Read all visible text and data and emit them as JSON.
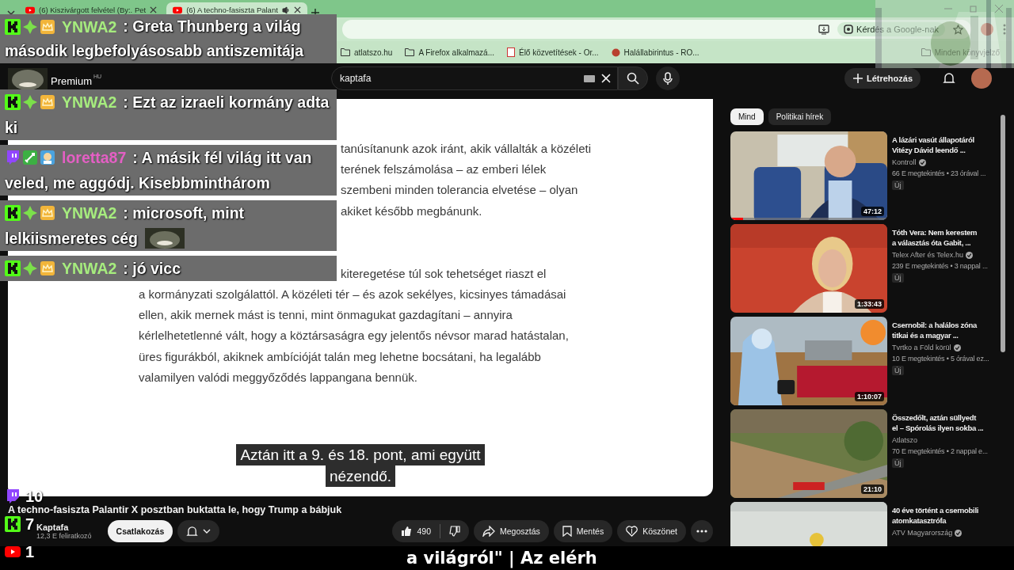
{
  "browser": {
    "tabs": [
      {
        "title": "(6) Kiszivárgott felvétel (By:. Pet",
        "selected": false,
        "audio": false
      },
      {
        "title": "(6) A techno-fasiszta Palant",
        "selected": true,
        "audio": true
      }
    ],
    "ask_google": "Kérdés a Google-nak",
    "bookmarks": [
      {
        "label": "atlatszo.hu",
        "kind": "folder"
      },
      {
        "label": "A Firefox alkalmazá...",
        "kind": "folder"
      },
      {
        "label": "Élő közvetítések - Or...",
        "kind": "live"
      },
      {
        "label": "Halállabirintus - RO...",
        "kind": "game"
      }
    ],
    "all_bookmarks": "Minden könyvjelző"
  },
  "youtube": {
    "premium": "Premium",
    "region": "HU",
    "search": {
      "value": "kaptafa"
    },
    "create": "Létrehozás"
  },
  "video": {
    "document": {
      "paragraphs": [
        {
          "lines": [
            {
              "text": "tanúsítanunk azok iránt, akik vállalták a közéleti",
              "kind": "fragment"
            },
            {
              "text": "terének felszámolása – az emberi lélek",
              "kind": "fragment"
            },
            {
              "text": "szembeni minden tolerancia elvetése – olyan",
              "kind": "fragment"
            },
            {
              "text": "akiket később megbánunk.",
              "kind": "fragment"
            }
          ]
        },
        {
          "lines": [
            {
              "text": "kiteregetése túl sok tehetséget riaszt el",
              "kind": "fragment"
            },
            {
              "text": "a kormányzati szolgálattól. A közéleti tér – és azok sekélyes, kicsinyes támadásai",
              "kind": "line"
            },
            {
              "text": "ellen, akik mernek mást is tenni, mint önmagukat gazdagítani – annyira",
              "kind": "line"
            },
            {
              "text": "kérlelhetetlenné vált, hogy a köztársaságra egy jelentős névsor marad hatástalan,",
              "kind": "line"
            },
            {
              "text": "üres figurákból, akiknek ambícióját talán meg lehetne bocsátani, ha legalább",
              "kind": "line"
            },
            {
              "text": "valamilyen valódi meggyőződés lappangana bennük.",
              "kind": "line"
            }
          ]
        }
      ]
    },
    "captions": [
      "Aztán itt a 9. és 18. pont, ami együtt",
      "nézendő."
    ],
    "title": "A techno-fasiszta Palantir X posztban buktatta le, hogy Trump a bábjuk",
    "channel": {
      "name": "Kaptafa",
      "subscribers": "12,3 E feliratkozó"
    },
    "join": "Csatlakozás",
    "likes": "490",
    "actions": [
      {
        "label": "Megosztás",
        "kind": "share"
      },
      {
        "label": "Mentés",
        "kind": "save"
      },
      {
        "label": "Köszönet",
        "kind": "thanks"
      }
    ]
  },
  "sidebar": {
    "chips": [
      {
        "label": "Mind",
        "selected": true
      },
      {
        "label": "Politikai hírek",
        "selected": false
      }
    ],
    "videos": [
      {
        "title": [
          "A lázári vasút állapotáról",
          "Vitézy Dávid leendő ..."
        ],
        "channel": "Kontroll",
        "verified": true,
        "meta": "66 E megtekintés • 23 órával ...",
        "badge": "Új",
        "duration": "47:12",
        "level": 0.08
      },
      {
        "title": [
          "Tóth Vera: Nem kerestem",
          "a választás óta Gabit, ..."
        ],
        "channel": "Telex After és Telex.hu",
        "verified": true,
        "meta": "239 E megtekintés • 3 nappal ...",
        "badge": "Új",
        "duration": "1:33:43"
      },
      {
        "title": [
          "Csernobil: a halálos zóna",
          "titkai és a magyar ..."
        ],
        "channel": "Tvrtko a Föld körül",
        "verified": true,
        "meta": "10 E megtekintés • 5 órával ez...",
        "badge": "Új",
        "duration": "1:10:07"
      },
      {
        "title": [
          "Összedőlt, aztán süllyedt",
          "el – Spórolás ilyen sokba ..."
        ],
        "channel": "Atlatszo",
        "verified": false,
        "meta": "70 E megtekintés • 2 nappal e...",
        "badge": "Új",
        "duration": "21:10"
      },
      {
        "title": [
          "40 éve történt a csernobili",
          "atomkatasztrófa"
        ],
        "channel": "ATV Magyarország",
        "verified": true
      }
    ]
  },
  "chat": [
    {
      "kind": "kick",
      "user": "YNWA2",
      "color": "#a6ec7e",
      "lines": [
        ": Greta Thunberg a világ",
        "második legbefolyásosabb antiszemitája"
      ],
      "emote": false
    },
    {
      "kind": "kick",
      "user": "YNWA2",
      "color": "#a6ec7e",
      "lines": [
        ": Ezt az izraeli kormány adta",
        "ki"
      ],
      "emote": false
    },
    {
      "kind": "twitch",
      "user": "loretta87",
      "color": "#e45fc4",
      "lines": [
        ": A másik fél világ itt van",
        "veled, me aggódj. Kisebbminthárom"
      ],
      "emote": false
    },
    {
      "kind": "kick",
      "user": "YNWA2",
      "color": "#a6ec7e",
      "lines": [
        ": microsoft, mint",
        "lelkiismeretes cég"
      ],
      "emote": true
    },
    {
      "kind": "kick",
      "user": "YNWA2",
      "color": "#a6ec7e",
      "lines": [
        ": jó vicc"
      ],
      "emote": false
    }
  ],
  "viewers": [
    {
      "kind": "twitch",
      "count": "10"
    },
    {
      "kind": "kick",
      "count": "7"
    },
    {
      "kind": "youtube",
      "count": "1"
    }
  ],
  "ticker": "a világról\" | Az elérh"
}
